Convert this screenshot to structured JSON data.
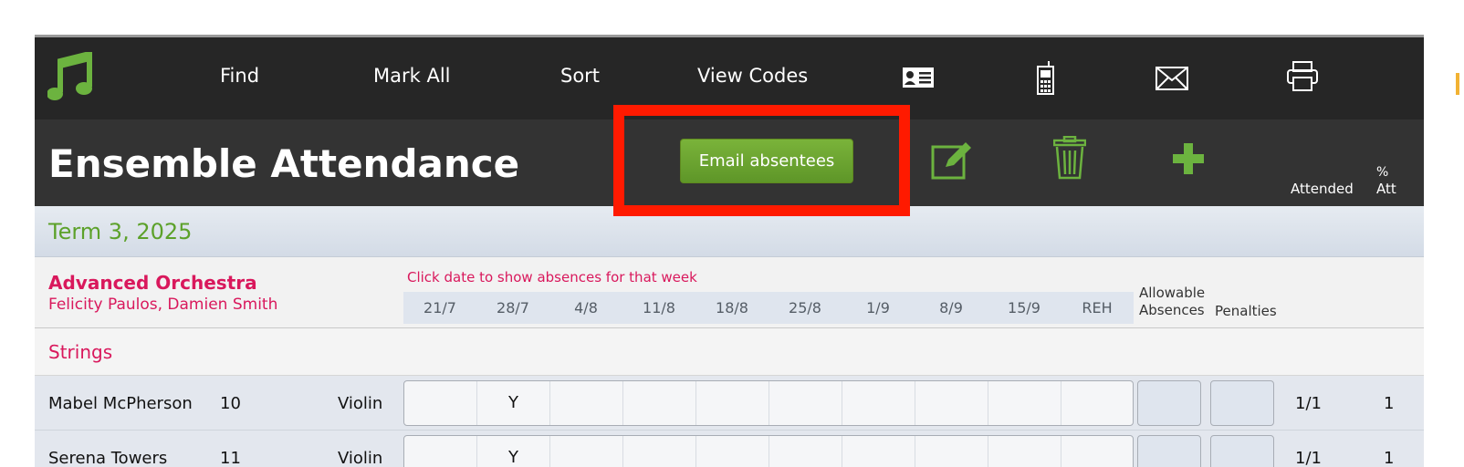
{
  "toolbar": {
    "find_label": "Find",
    "mark_all_label": "Mark All",
    "sort_label": "Sort",
    "view_codes_label": "View Codes",
    "icons": [
      "music-note-icon",
      "contact-card-icon",
      "mobile-phone-icon",
      "envelope-icon",
      "printer-icon"
    ]
  },
  "header": {
    "title": "Ensemble Attendance",
    "email_button_label": "Email absentees",
    "col_attended": "Attended",
    "col_percent_line1": "%",
    "col_percent_line2": "Att",
    "icons": [
      "edit-icon",
      "trash-icon",
      "add-icon"
    ]
  },
  "term": {
    "label": "Term 3, 2025"
  },
  "ensemble": {
    "name": "Advanced Orchestra",
    "teachers": "Felicity Paulos, Damien Smith",
    "hint": "Click date to show absences for that week",
    "dates": [
      "21/7",
      "28/7",
      "4/8",
      "11/8",
      "18/8",
      "25/8",
      "1/9",
      "8/9",
      "15/9",
      "REH"
    ],
    "allowable_line1": "Allowable",
    "allowable_line2": "Absences",
    "penalties": "Penalties"
  },
  "section": {
    "label": "Strings"
  },
  "students": [
    {
      "name": "Mabel McPherson",
      "year": "10",
      "instrument": "Violin",
      "marks": [
        "",
        "Y",
        "",
        "",
        "",
        "",
        "",
        "",
        "",
        ""
      ],
      "attended": "1/1",
      "percent": "1"
    },
    {
      "name": "Serena Towers",
      "year": "11",
      "instrument": "Violin",
      "marks": [
        "",
        "Y",
        "",
        "",
        "",
        "",
        "",
        "",
        "",
        ""
      ],
      "attended": "1/1",
      "percent": "1"
    }
  ],
  "colors": {
    "accent_green": "#5ca12a",
    "ensemble_pink": "#d9185c",
    "highlight_red": "#ff1a00",
    "toolbar_bg": "#262626"
  }
}
